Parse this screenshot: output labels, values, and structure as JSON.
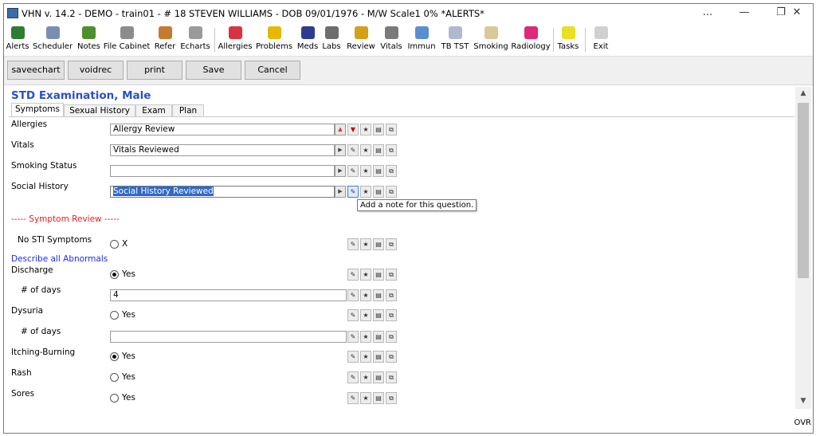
{
  "window": {
    "title": "VHN v. 14.2 - DEMO - train01 - # 18  STEVEN WILLIAMS - DOB 09/01/1976 - M/W  Scale1   0% *ALERTS*",
    "controls": [
      "...",
      "—",
      "❐",
      "✕"
    ]
  },
  "toolbar": {
    "items": [
      {
        "label": "Alerts",
        "icon": "alerts-icon",
        "color": "#2e7d32"
      },
      {
        "label": "Scheduler",
        "icon": "calendar-icon",
        "color": "#7a8fb0"
      },
      {
        "label": "Notes",
        "icon": "notes-icon",
        "color": "#4e8f2e"
      },
      {
        "label": "File Cabinet",
        "icon": "file-cabinet-icon",
        "color": "#8c8c8c"
      },
      {
        "label": "Refer",
        "icon": "refer-icon",
        "color": "#c47b2b"
      },
      {
        "label": "Echarts",
        "icon": "echarts-icon",
        "color": "#9a9a9a"
      },
      {
        "label": "Allergies",
        "icon": "allergies-icon",
        "color": "#d9333f"
      },
      {
        "label": "Problems",
        "icon": "problems-icon",
        "color": "#e6b800"
      },
      {
        "label": "Meds",
        "icon": "rx-icon",
        "color": "#2a3d8f"
      },
      {
        "label": "Labs",
        "icon": "labs-icon",
        "color": "#6d6d6d"
      },
      {
        "label": "Review",
        "icon": "review-icon",
        "color": "#d4a017"
      },
      {
        "label": "Vitals",
        "icon": "stethoscope-icon",
        "color": "#7a7a7a"
      },
      {
        "label": "Immun",
        "icon": "syringe-icon",
        "color": "#5a8fcf"
      },
      {
        "label": "TB TST",
        "icon": "tb-test-icon",
        "color": "#b0b8d0"
      },
      {
        "label": "Smoking",
        "icon": "smoking-icon",
        "color": "#d8c89a"
      },
      {
        "label": "Radiology",
        "icon": "radiation-icon",
        "color": "#e0287a"
      },
      {
        "label": "Tasks",
        "icon": "tasks-icon",
        "color": "#e8e020"
      },
      {
        "label": "Exit",
        "icon": "exit-icon",
        "color": "#d0d0d0"
      }
    ]
  },
  "actions": {
    "saveechart": "saveechart",
    "voidrec": "voidrec",
    "print": "print",
    "save": "Save",
    "cancel": "Cancel"
  },
  "form": {
    "heading": "STD Examination, Male",
    "tabs": [
      "Symptoms",
      "Sexual History",
      "Exam",
      "Plan"
    ],
    "allergies": {
      "label": "Allergies",
      "value": "Allergy Review"
    },
    "vitals": {
      "label": "Vitals",
      "value": "Vitals Reviewed"
    },
    "smoking": {
      "label": "Smoking Status",
      "value": ""
    },
    "social": {
      "label": "Social History",
      "value": "Social History Reviewed"
    },
    "tooltip": "Add a note for this question.",
    "symptom_header": "----- Symptom Review -----",
    "no_sti": {
      "label": "No STI Symptoms",
      "option": "X",
      "checked": false
    },
    "describe": "Describe all Abnormals",
    "discharge": {
      "label": "Discharge",
      "option": "Yes",
      "checked": true
    },
    "discharge_days": {
      "label": "# of days",
      "value": "4"
    },
    "dysuria": {
      "label": "Dysuria",
      "option": "Yes",
      "checked": false
    },
    "dysuria_days": {
      "label": "# of days",
      "value": ""
    },
    "itching": {
      "label": "Itching-Burning",
      "option": "Yes",
      "checked": true
    },
    "rash": {
      "label": "Rash",
      "option": "Yes",
      "checked": false
    },
    "sores": {
      "label": "Sores",
      "option": "Yes",
      "checked": false
    }
  },
  "status": {
    "mode": "OVR"
  }
}
